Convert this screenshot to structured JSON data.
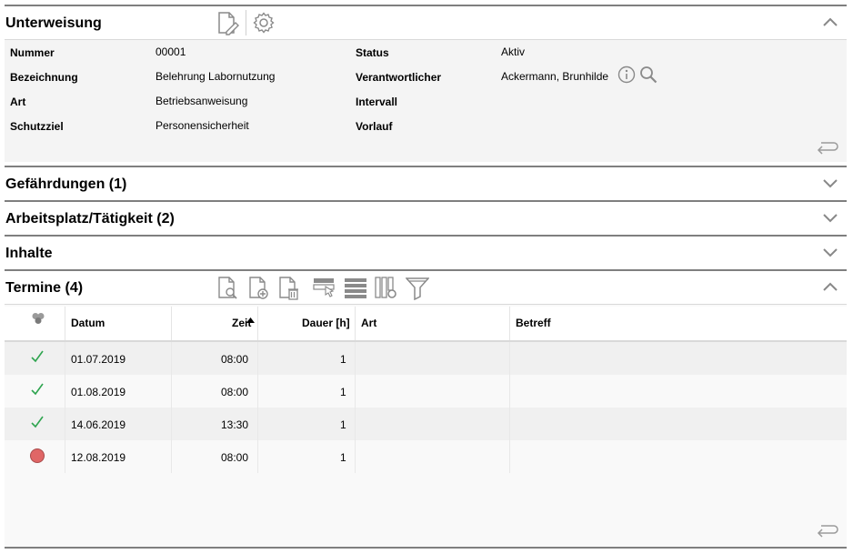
{
  "unterweisung": {
    "title": "Unterweisung",
    "fields_left": [
      {
        "label": "Nummer",
        "value": "00001"
      },
      {
        "label": "Bezeichnung",
        "value": "Belehrung Labornutzung"
      },
      {
        "label": "Art",
        "value": "Betriebsanweisung"
      },
      {
        "label": "Schutzziel",
        "value": "Personensicherheit"
      }
    ],
    "fields_right": [
      {
        "label": "Status",
        "value": "Aktiv"
      },
      {
        "label": "Verantwortlicher",
        "value": "Ackermann, Brunhilde"
      },
      {
        "label": "Intervall",
        "value": ""
      },
      {
        "label": "Vorlauf",
        "value": ""
      }
    ]
  },
  "sections": {
    "gefaehrdungen": "Gefährdungen (1)",
    "arbeitsplatz": "Arbeitsplatz/Tätigkeit (2)",
    "inhalte": "Inhalte",
    "termine": "Termine (4)"
  },
  "termine_table": {
    "columns": {
      "status": "",
      "datum": "Datum",
      "zeit": "Zeit",
      "dauer": "Dauer [h]",
      "art": "Art",
      "betreff": "Betreff"
    },
    "rows": [
      {
        "status": "done",
        "datum": "01.07.2019",
        "zeit": "08:00",
        "dauer": "1",
        "art": "",
        "betreff": ""
      },
      {
        "status": "done",
        "datum": "01.08.2019",
        "zeit": "08:00",
        "dauer": "1",
        "art": "",
        "betreff": ""
      },
      {
        "status": "done",
        "datum": "14.06.2019",
        "zeit": "13:30",
        "dauer": "1",
        "art": "",
        "betreff": ""
      },
      {
        "status": "open",
        "datum": "12.08.2019",
        "zeit": "08:00",
        "dauer": "1",
        "art": "",
        "betreff": ""
      }
    ]
  },
  "colors": {
    "check": "#2ea44f",
    "open_dot": "#e06666",
    "row_alt": "#f0f0f0",
    "row": "#f9f9f9"
  }
}
